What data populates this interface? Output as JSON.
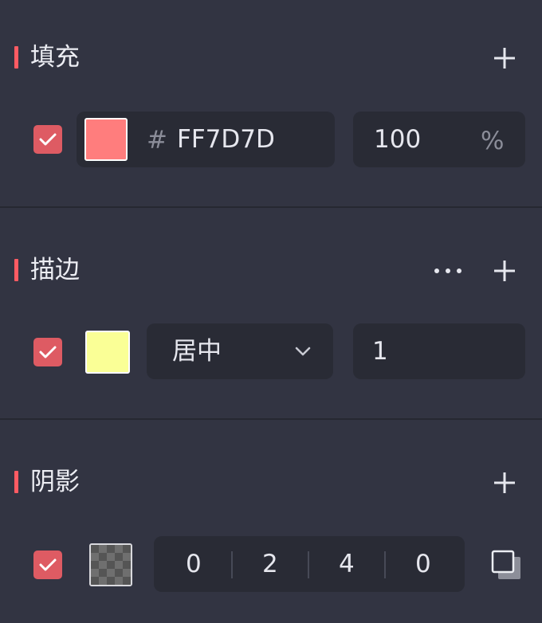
{
  "fill": {
    "title": "填充",
    "add_icon": "plus-icon",
    "enabled": true,
    "color": "#FF7D7D",
    "hash_symbol": "#",
    "hex_value": "FF7D7D",
    "opacity_value": "100",
    "opacity_unit": "%"
  },
  "stroke": {
    "title": "描边",
    "more_icon": "more-horizontal-icon",
    "add_icon": "plus-icon",
    "enabled": true,
    "color": "#FAFF96",
    "position_value": "居中",
    "dropdown_icon": "chevron-down-icon",
    "width_value": "1"
  },
  "shadow": {
    "title": "阴影",
    "add_icon": "plus-icon",
    "enabled": true,
    "color_icon": "transparent-checker-swatch",
    "values": [
      "0",
      "2",
      "4",
      "0"
    ],
    "type_icon": "drop-shadow-icon"
  },
  "colors": {
    "accent": "#DE5B63",
    "background": "#323442",
    "field_background": "#292B35",
    "divider": "#262831"
  }
}
